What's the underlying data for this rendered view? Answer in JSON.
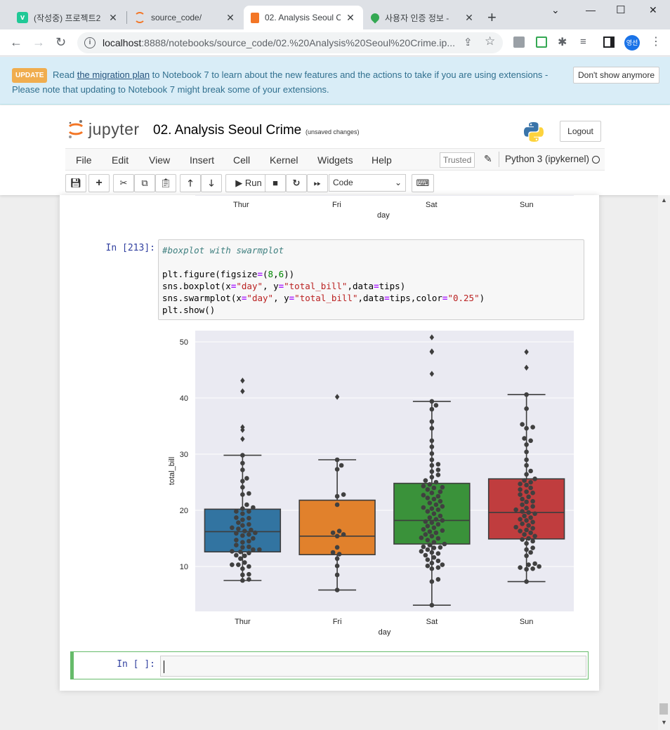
{
  "browser": {
    "tabs": [
      {
        "title": "(작성중) 프로젝트2",
        "icon": "velog-icon",
        "color": "#20c997"
      },
      {
        "title": "source_code/",
        "icon": "jupyter-icon",
        "color": "#f37626"
      },
      {
        "title": "02. Analysis Seoul C",
        "icon": "notebook-icon",
        "color": "#f37626"
      },
      {
        "title": "사용자 인증 정보 -",
        "icon": "maps-icon",
        "color": "#34a853"
      }
    ],
    "url_host": "localhost",
    "url_path": ":8888/notebooks/source_code/02.%20Analysis%20Seoul%20Crime.ip...",
    "profile_label": "영선"
  },
  "banner": {
    "badge": "UPDATE",
    "text_before": "Read",
    "link": "the migration plan",
    "text_after": "to Notebook 7 to learn about the new features and the actions to take if you are using extensions - Please note that updating to Notebook 7 might break some of your extensions.",
    "dismiss_label": "Don't show anymore"
  },
  "header": {
    "logo_word": "jupyter",
    "notebook_name": "02. Analysis Seoul Crime",
    "save_status": "(unsaved changes)",
    "logout_label": "Logout"
  },
  "menu": {
    "items": [
      "File",
      "Edit",
      "View",
      "Insert",
      "Cell",
      "Kernel",
      "Widgets",
      "Help"
    ],
    "trusted_label": "Trusted",
    "kernel_name": "Python 3 (ipykernel)"
  },
  "toolbar": {
    "run_label": "Run",
    "cell_type": "Code"
  },
  "prev_output": {
    "categories": [
      "Thur",
      "Fri",
      "Sat",
      "Sun"
    ],
    "xlabel": "day"
  },
  "cell": {
    "prompt": "In [213]:",
    "code": [
      "#boxplot with swarmplot",
      "",
      "plt.figure(figsize=(8,6))",
      "sns.boxplot(x=\"day\", y=\"total_bill\",data=tips)",
      "sns.swarmplot(x=\"day\", y=\"total_bill\",data=tips,color=\"0.25\")",
      "plt.show()"
    ]
  },
  "new_cell": {
    "prompt": "In [ ]:"
  },
  "chart_data": {
    "type": "box",
    "title": "",
    "xlabel": "day",
    "ylabel": "total_bill",
    "ylim": [
      2,
      52
    ],
    "yticks": [
      10,
      20,
      30,
      40,
      50
    ],
    "background": "#eaeaf2",
    "grid": true,
    "categories": [
      "Thur",
      "Fri",
      "Sat",
      "Sun"
    ],
    "colors": [
      "#3274a1",
      "#e1812c",
      "#3a923a",
      "#c03d3e"
    ],
    "boxes": [
      {
        "min": 7.5,
        "q1": 12.6,
        "median": 16.2,
        "q3": 20.2,
        "max": 29.8
      },
      {
        "min": 5.8,
        "q1": 12.1,
        "median": 15.4,
        "q3": 21.8,
        "max": 29.0
      },
      {
        "min": 3.1,
        "q1": 14.0,
        "median": 18.2,
        "q3": 24.8,
        "max": 39.4
      },
      {
        "min": 7.3,
        "q1": 14.9,
        "median": 19.6,
        "q3": 25.6,
        "max": 40.6
      }
    ],
    "outliers": [
      [
        32.7,
        34.3,
        34.8,
        41.2,
        43.1
      ],
      [
        40.2
      ],
      [
        44.3,
        48.2,
        48.3,
        50.8
      ],
      [
        45.4,
        48.2
      ]
    ],
    "swarm_values": [
      [
        7.5,
        7.7,
        8.5,
        8.6,
        9.6,
        10.0,
        10.3,
        10.3,
        10.7,
        11.4,
        11.9,
        12.0,
        12.4,
        12.6,
        12.7,
        13.0,
        13.0,
        13.4,
        13.5,
        13.8,
        14.3,
        14.5,
        14.7,
        15.0,
        15.5,
        15.7,
        15.9,
        16.0,
        16.3,
        16.5,
        16.7,
        16.9,
        17.3,
        17.5,
        17.8,
        18.3,
        18.6,
        18.7,
        19.4,
        19.8,
        19.8,
        20.3,
        20.5,
        21.0,
        22.8,
        23.0,
        24.1,
        25.2,
        25.7,
        27.2,
        28.4,
        29.8
      ],
      [
        5.8,
        8.5,
        10.1,
        11.4,
        12.2,
        12.5,
        13.4,
        15.4,
        15.7,
        16.0,
        16.3,
        21.0,
        22.5,
        22.8,
        27.3,
        28.0,
        29.0
      ],
      [
        3.1,
        7.3,
        7.7,
        9.6,
        9.8,
        10.1,
        10.3,
        10.6,
        11.0,
        11.2,
        11.6,
        12.0,
        12.3,
        12.5,
        12.7,
        13.0,
        13.3,
        13.4,
        13.5,
        13.8,
        14.0,
        14.3,
        14.7,
        15.0,
        15.1,
        15.4,
        15.7,
        16.0,
        16.2,
        16.4,
        16.6,
        16.9,
        17.2,
        17.5,
        17.8,
        18.0,
        18.2,
        18.4,
        18.7,
        19.0,
        19.4,
        19.8,
        20.1,
        20.3,
        20.5,
        20.7,
        21.0,
        21.3,
        21.6,
        22.0,
        22.2,
        22.5,
        22.7,
        23.1,
        23.3,
        23.7,
        24.0,
        24.1,
        24.3,
        24.6,
        25.0,
        25.3,
        25.9,
        26.3,
        26.9,
        27.2,
        28.0,
        28.2,
        29.0,
        30.1,
        31.3,
        32.4,
        34.6,
        35.8,
        38.0,
        38.7,
        39.4
      ],
      [
        7.3,
        9.5,
        9.6,
        9.8,
        10.0,
        10.3,
        10.5,
        11.9,
        12.5,
        13.0,
        13.3,
        14.1,
        14.5,
        14.8,
        15.0,
        15.4,
        15.7,
        16.0,
        16.3,
        16.5,
        16.8,
        17.0,
        17.3,
        17.6,
        17.9,
        18.2,
        18.4,
        18.7,
        19.0,
        19.4,
        19.6,
        19.8,
        20.1,
        20.4,
        20.7,
        21.0,
        21.5,
        21.6,
        22.0,
        22.4,
        22.8,
        23.1,
        23.3,
        23.7,
        24.0,
        24.5,
        24.7,
        25.0,
        25.3,
        25.6,
        26.4,
        27.0,
        28.0,
        29.0,
        30.4,
        31.7,
        32.4,
        32.8,
        34.6,
        34.8,
        35.3,
        38.1,
        40.6
      ]
    ]
  }
}
